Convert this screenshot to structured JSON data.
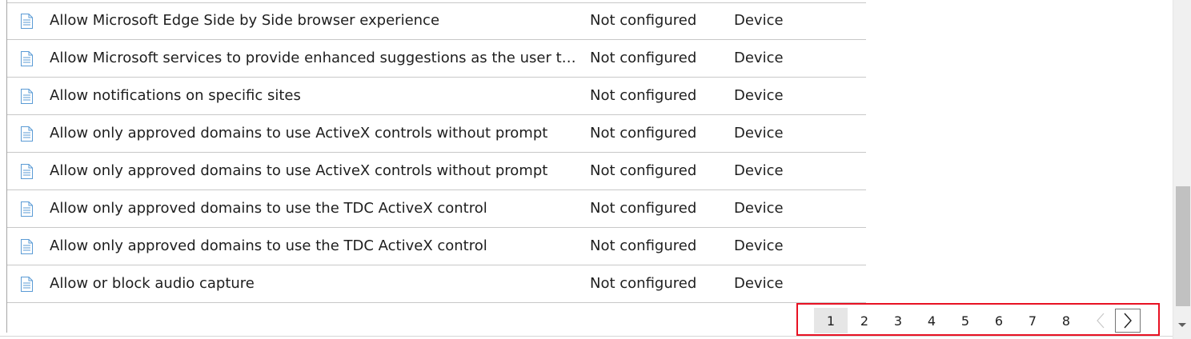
{
  "settings_table": {
    "rows": [
      {
        "name": "Allow Microsoft Edge Side by Side browser experience",
        "state": "Not configured",
        "scope": "Device",
        "icon": "document-icon"
      },
      {
        "name": "Allow Microsoft services to provide enhanced suggestions as the user types in the Address bar",
        "state": "Not configured",
        "scope": "Device",
        "icon": "document-icon"
      },
      {
        "name": "Allow notifications on specific sites",
        "state": "Not configured",
        "scope": "Device",
        "icon": "document-icon"
      },
      {
        "name": "Allow only approved domains to use ActiveX controls without prompt",
        "state": "Not configured",
        "scope": "Device",
        "icon": "document-icon"
      },
      {
        "name": "Allow only approved domains to use ActiveX controls without prompt",
        "state": "Not configured",
        "scope": "Device",
        "icon": "document-icon"
      },
      {
        "name": "Allow only approved domains to use the TDC ActiveX control",
        "state": "Not configured",
        "scope": "Device",
        "icon": "document-icon"
      },
      {
        "name": "Allow only approved domains to use the TDC ActiveX control",
        "state": "Not configured",
        "scope": "Device",
        "icon": "document-icon"
      },
      {
        "name": "Allow or block audio capture",
        "state": "Not configured",
        "scope": "Device",
        "icon": "document-icon"
      }
    ]
  },
  "pagination": {
    "pages": [
      "1",
      "2",
      "3",
      "4",
      "5",
      "6",
      "7",
      "8"
    ],
    "current_page": "1",
    "prev_icon": "chevron-left-icon",
    "next_icon": "chevron-right-icon",
    "highlight_color": "#e81123"
  },
  "colors": {
    "icon_blue": "#5b9bd5",
    "divider": "#c8c8c8",
    "active_page_bg": "#e6e6e6"
  }
}
